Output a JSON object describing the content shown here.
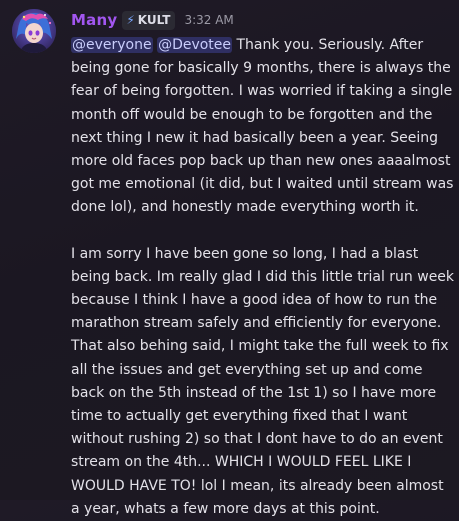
{
  "message": {
    "author": {
      "name": "Many",
      "name_color": "#a256f0",
      "role_icon": "lightning-bolt-icon",
      "role_tag": "KULT",
      "avatar": "avatar-anime-character"
    },
    "timestamp": "3:32 AM",
    "mentions": [
      "@everyone",
      "@Devotee"
    ],
    "paragraph_1_text": " Thank you. Seriously. After being gone for basically 9 months, there is always the fear of being forgotten. I was worried if taking a single month off would be enough to be forgotten and the next thing I new it had basically been a year. Seeing more old faces pop back up than new ones aaaalmost got me emotional (it did, but I waited until stream was done lol), and honestly made everything worth it.",
    "paragraph_2_text": "I am sorry I have been gone so long, I had a blast being back. Im really glad I did this little trial run week because I think I have a good idea of how to run the marathon stream safely and efficiently for everyone. That also behing said, I might take the full week to fix all the issues and get everything set up and come back on the 5th instead of the 1st 1) so I have more time to actually get everything fixed that I want without rushing 2) so that I dont have to do an event stream on the 4th... WHICH I WOULD FEEL LIKE I WOULD HAVE TO! lol I mean, its already been almost a year, whats a few more days at this point."
  }
}
